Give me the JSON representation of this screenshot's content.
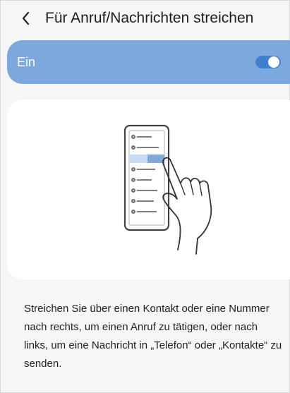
{
  "header": {
    "title": "Für Anruf/Nachrichten streichen",
    "back_icon": "chevron-left-icon"
  },
  "toggle": {
    "label": "Ein",
    "state": "on",
    "bar_color": "#7ca9dd",
    "active_color": "#3f7fd0"
  },
  "illustration": {
    "description_icon": "swipe-on-contact-illustration"
  },
  "description": "Streichen Sie über einen Kontakt oder eine Nummer nach rechts, um einen Anruf zu tätigen, oder nach links, um eine Nachricht in „Telefon“ oder „Kontakte“ zu senden."
}
